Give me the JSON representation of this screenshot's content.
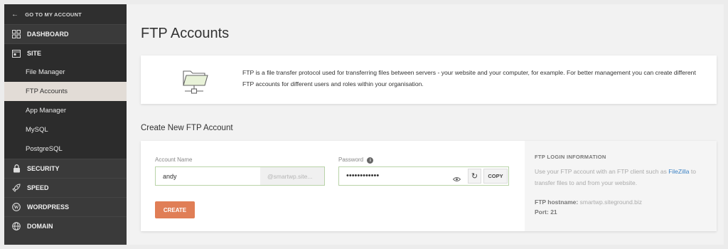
{
  "sidebar": {
    "back_label": "GO TO MY ACCOUNT",
    "sections": [
      {
        "label": "DASHBOARD",
        "icon": "dashboard-icon"
      },
      {
        "label": "SITE",
        "icon": "site-icon"
      },
      {
        "label": "SECURITY",
        "icon": "lock-icon"
      },
      {
        "label": "SPEED",
        "icon": "rocket-icon"
      },
      {
        "label": "WORDPRESS",
        "icon": "wordpress-icon"
      },
      {
        "label": "DOMAIN",
        "icon": "globe-icon"
      }
    ],
    "site_items": [
      {
        "label": "File Manager"
      },
      {
        "label": "FTP Accounts"
      },
      {
        "label": "App Manager"
      },
      {
        "label": "MySQL"
      },
      {
        "label": "PostgreSQL"
      }
    ],
    "active_item": "FTP Accounts"
  },
  "page": {
    "title": "FTP Accounts",
    "intro_text": "FTP is a file transfer protocol used for transferring files between servers - your website and your computer, for example. For better management you can create different FTP accounts for different users and roles within your organisation.",
    "section_title": "Create New FTP Account"
  },
  "form": {
    "account_label": "Account Name",
    "account_value": "andy",
    "domain_suffix": "@smartwp.site...",
    "password_label": "Password",
    "password_value": "••••••••••••",
    "copy_label": "COPY",
    "create_label": "CREATE"
  },
  "info": {
    "heading": "FTP LOGIN INFORMATION",
    "text_before": "Use your FTP account with an FTP client such as ",
    "link": "FileZilla",
    "text_after": " to transfer files to and from your website.",
    "hostname_label": "FTP hostname:",
    "hostname_value": "smartwp.siteground.biz",
    "port_label": "Port: 21"
  },
  "colors": {
    "sidebar_bg": "#3a3a3a",
    "active_bg": "#e2dcd6",
    "accent": "#e07e56",
    "link": "#3c82c4",
    "field_border": "#b9d3a8"
  }
}
